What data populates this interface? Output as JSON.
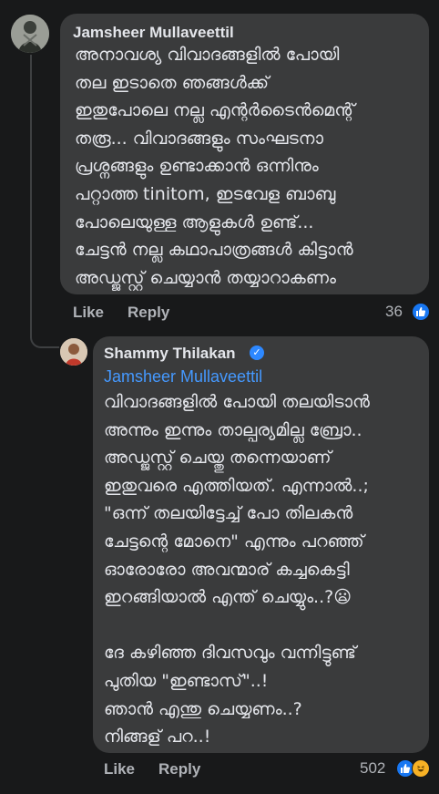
{
  "comment": {
    "author": "Jamsheer Mullaveettil",
    "text": "അനാവശ്യ  വിവാദങ്ങളിൽ പോയി\nതല ഇടാതെ  ഞങ്ങൾക്ക്\nഇതുപോലെ  നല്ല എന്റർടൈൻമെന്റ്\nതരൂ... വിവാദങ്ങളും സംഘടനാ\nപ്രശ്നങ്ങളും  ഉണ്ടാക്കാൻ  ഒന്നിനും\nപറ്റാത്ത tinitom, ഇടവേള  ബാബു\nപോലെയുള്ള ആളുകൾ  ഉണ്ട്...\nചേട്ടൻ  നല്ല കഥാപാത്രങ്ങൾ  കിട്ടാൻ\nഅഡ്ജസ്റ്റ് ചെയ്യാൻ  തയ്യാറാകണം",
    "like_label": "Like",
    "reply_label": "Reply",
    "reaction_count": "36",
    "reaction_icons": [
      "like-reaction-icon"
    ]
  },
  "reply": {
    "author": "Shammy Thilakan",
    "verified_icon": "verified-badge-icon",
    "mention": "Jamsheer Mullaveettil",
    "text": "വിവാദങ്ങളിൽ പോയി തലയിടാൻ\nഅന്നും ഇന്നും താല്പര്യമില്ല ബ്രോ..\nഅഡ്ജസ്റ്റ് ചെയ്തു തന്നെയാണ്\nഇതുവരെ എത്തിയത്. എന്നാൽ..;\n\"ഒന്ന് തലയിട്ടേച്ച് പോ തിലകൻ\nചേട്ടന്റെ മോനെ\" എന്നും പറഞ്ഞ്\nഓരോരോ അവന്മാര് കച്ചകെട്ടി\nഇറങ്ങിയാൽ എന്ത് ചെയ്യും..?😦\n\nദേ കഴിഞ്ഞ ദിവസവും വന്നിട്ടുണ്ട്\nപുതിയ \"ഇണ്ടാസ്\"..!\nഞാൻ എന്തു ചെയ്യണം..?\nനിങ്ങള് പറ..!",
    "like_label": "Like",
    "reply_label": "Reply",
    "reaction_count": "502",
    "reaction_icons": [
      "like-reaction-icon",
      "haha-reaction-icon"
    ]
  },
  "colors": {
    "background": "#18191a",
    "bubble": "#3a3b3c",
    "text": "#e4e6eb",
    "secondary": "#b0b3b8",
    "mention": "#4599ff",
    "verified": "#2d88ff"
  }
}
